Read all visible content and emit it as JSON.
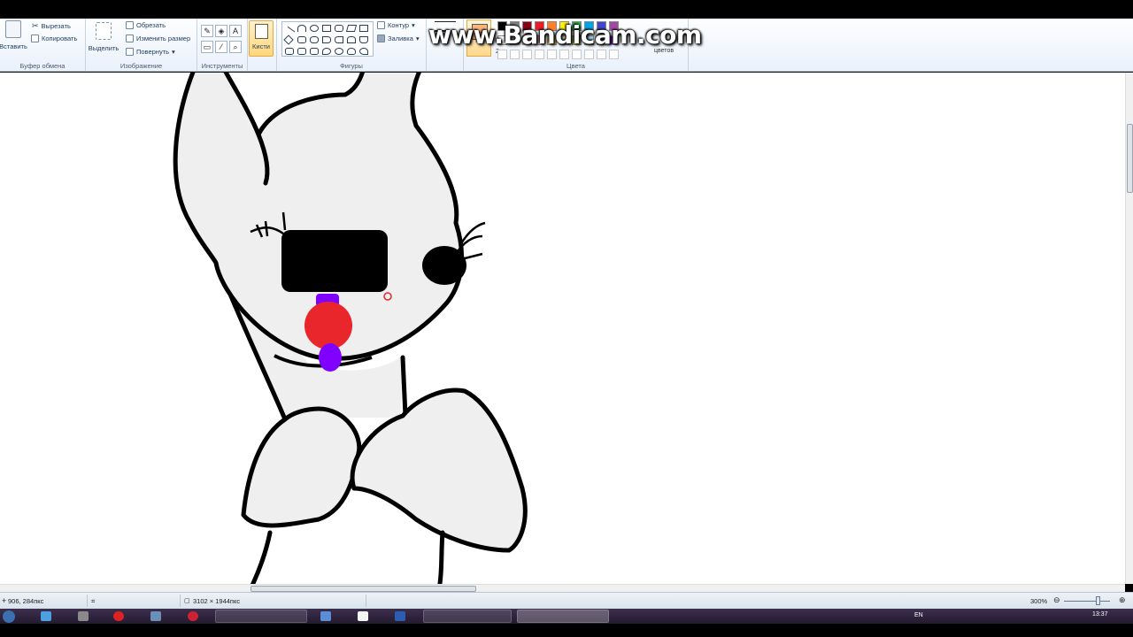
{
  "ribbon": {
    "clipboard": {
      "paste": "Вставить",
      "cut": "Вырезать",
      "copy": "Копировать",
      "group": "Буфер обмена"
    },
    "image": {
      "select": "Выделить",
      "crop": "Обрезать",
      "resize": "Изменить размер",
      "rotate": "Повернуть",
      "group": "Изображение"
    },
    "tools": {
      "text_tool": "A",
      "group": "Инструменты"
    },
    "brushes": {
      "label": "Кисти"
    },
    "shapes": {
      "outline": "Контур",
      "fill": "Заливка",
      "group": "Фигуры"
    },
    "colors": {
      "group": "Цвета",
      "edit_partial": "цветов",
      "color2_num": "2",
      "palette": [
        "#000000",
        "#7f7f7f",
        "#880015",
        "#ed1c24",
        "#ff7f27",
        "#fff200",
        "#22b14c",
        "#00a2e8",
        "#3f48cc",
        "#a349a4",
        "#ffffff",
        "#c3c3c3",
        "#b97a57",
        "#ffaec9",
        "#ffc90e",
        "#efe4b0",
        "#b5e61d",
        "#99d9ea",
        "#7092be",
        "#8000ff"
      ],
      "selected": "#fdb67a"
    }
  },
  "watermark": "www.Bandicam.com",
  "status": {
    "cursor_pos": "906, 284пкс",
    "image_size": "3102 × 1944пкс",
    "zoom": "300%"
  },
  "taskbar": {
    "lang": "EN",
    "time": "13:37"
  }
}
